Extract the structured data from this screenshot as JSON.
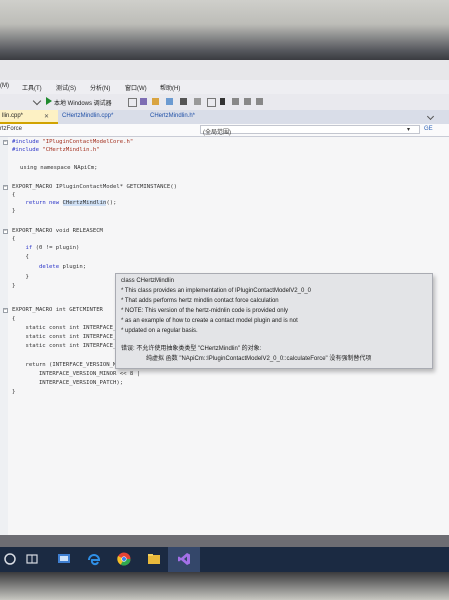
{
  "menu": {
    "items": [
      "(M)",
      "工具(T)",
      "测试(S)",
      "分析(N)",
      "窗口(W)",
      "帮助(H)"
    ]
  },
  "toolbar": {
    "debug_target": "本地 Windows 调试器"
  },
  "tabs": [
    {
      "label": "llin.cpp*",
      "active": true
    },
    {
      "label": "CHertzMindlin.cpp*",
      "active": false
    },
    {
      "label": "CHertzMindlin.h*",
      "active": false
    }
  ],
  "navbar": {
    "left_label": "rtzForce",
    "scope_label": "(全局范围)",
    "right_label": "GE"
  },
  "code_lines": [
    "#include \"IPluginContactModelCore.h\"",
    "#include \"CHertzMindlin.h\"",
    "using namespace NApiCm;",
    "EXPORT_MACRO IPluginContactModel* GETCMINSTANCE()",
    "{",
    "    return new CHertzMindlin();",
    "}",
    "EXPORT_MACRO void RELEASECM",
    "{",
    "    if (0 != plugin)",
    "    {",
    "        delete plugin;",
    "    }",
    "}",
    "EXPORT_MACRO int GETCMINTER",
    "{",
    "    static const int INTERFACE_VERSION_MAJOR = 0x02;",
    "    static const int INTERFACE_VERSION_MINOR = 0x00;",
    "    static const int INTERFACE_VERSION_PATCH = 0x00;",
    "    return (INTERFACE_VERSION_MAJOR << 16 |",
    "        INTERFACE_VERSION_MINOR << 8 |",
    "        INTERFACE_VERSION_PATCH);",
    "}"
  ],
  "tooltip": {
    "title": "class CHertzMindlin",
    "lines": [
      "* This class provides an implementation of IPluginContactModelV2_0_0",
      "* That adds performs hertz mindlin contact force calculation",
      "* NOTE: This version of the hertz-midnlin code is provided only",
      "* as an example of how to create a contact model plugin and is not",
      "* updated on a regular basis."
    ],
    "error_1": "错误: 不允许使用抽象类类型 \"CHertzMindlin\" 的对象:",
    "error_2": "纯虚拟 函数 \"NApiCm::IPluginContactModelV2_0_0::calculateForce\" 没有强制替代项"
  },
  "colors": {
    "active_tab_bg": "#fdf1c4",
    "tab_text": "#1e4fa7",
    "keyword": "#2b35c8",
    "string": "#a3301f",
    "taskbar": "#1b2a42"
  },
  "taskbar_icons": [
    "windows-start-icon",
    "task-view-icon",
    "desktop-app-icon",
    "edge-icon",
    "chrome-icon",
    "file-explorer-icon",
    "visual-studio-icon"
  ]
}
